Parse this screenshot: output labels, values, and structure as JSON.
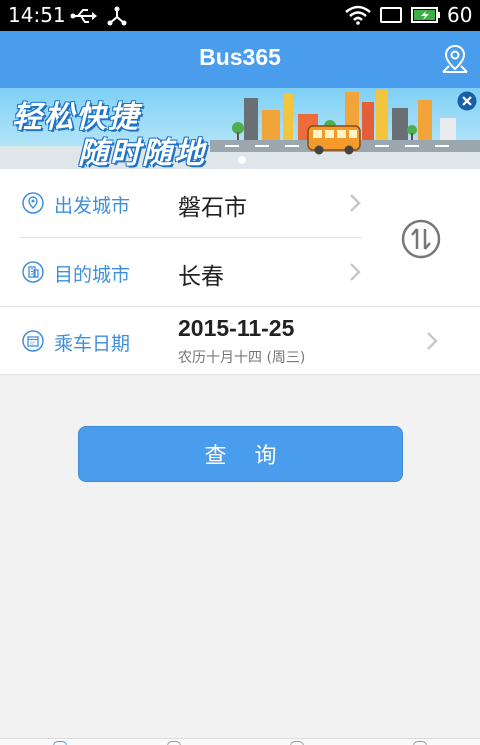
{
  "status_bar": {
    "time": "14:51",
    "battery": "60"
  },
  "app_bar": {
    "title": "Bus365",
    "map_icon": "map-pin-icon"
  },
  "banner": {
    "slogan_line1": "轻松快捷",
    "slogan_line2": "随时随地",
    "close_icon": "close-icon"
  },
  "form": {
    "departure": {
      "label": "出发城市",
      "value": "磐石市",
      "icon": "location-icon"
    },
    "destination": {
      "label": "目的城市",
      "value": "长春",
      "icon": "building-icon"
    },
    "date": {
      "label": "乘车日期",
      "value": "2015-11-25",
      "sub": "农历十月十四 (周三)",
      "icon": "calendar-icon"
    },
    "swap_icon": "swap-icon"
  },
  "query_button": {
    "label": "查询"
  },
  "colors": {
    "accent": "#4a9cec",
    "label": "#3f8fdd",
    "background": "#f2f2f2"
  }
}
